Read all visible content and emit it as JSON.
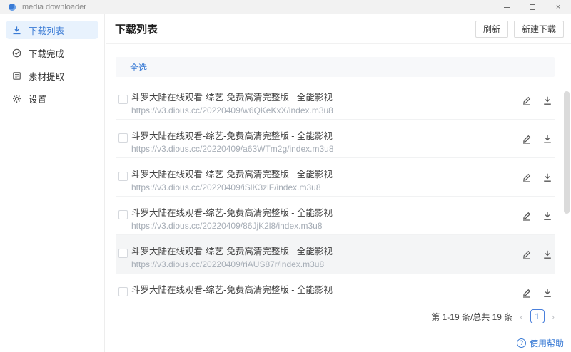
{
  "titlebar": {
    "app_title": "media downloader"
  },
  "icons": {
    "close": "×",
    "help": "?"
  },
  "sidebar": {
    "items": [
      {
        "label": "下载列表",
        "icon": "download-icon",
        "active": true
      },
      {
        "label": "下载完成",
        "icon": "check-circle-icon",
        "active": false
      },
      {
        "label": "素材提取",
        "icon": "extract-icon",
        "active": false
      },
      {
        "label": "设置",
        "icon": "gear-icon",
        "active": false
      }
    ]
  },
  "main": {
    "page_title": "下载列表",
    "refresh_button": "刷新",
    "new_download_button": "新建下载",
    "select_all": "全选"
  },
  "downloads": [
    {
      "title": "斗罗大陆在线观看-综艺-免费高清完整版 - 全能影视",
      "url": "https://v3.dious.cc/20220409/w6QKeKxX/index.m3u8",
      "hovered": false
    },
    {
      "title": "斗罗大陆在线观看-综艺-免费高清完整版 - 全能影视",
      "url": "https://v3.dious.cc/20220409/a63WTm2g/index.m3u8",
      "hovered": false
    },
    {
      "title": "斗罗大陆在线观看-综艺-免费高清完整版 - 全能影视",
      "url": "https://v3.dious.cc/20220409/iSlK3zlF/index.m3u8",
      "hovered": false
    },
    {
      "title": "斗罗大陆在线观看-综艺-免费高清完整版 - 全能影视",
      "url": "https://v3.dious.cc/20220409/86JjK2l8/index.m3u8",
      "hovered": false
    },
    {
      "title": "斗罗大陆在线观看-综艺-免费高清完整版 - 全能影视",
      "url": "https://v3.dious.cc/20220409/riAUS87r/index.m3u8",
      "hovered": true
    },
    {
      "title": "斗罗大陆在线观看-综艺-免费高清完整版 - 全能影视",
      "url": "",
      "hovered": false
    }
  ],
  "pagination": {
    "summary": "第 1-19 条/总共 19 条",
    "prev": "‹",
    "current_page": "1",
    "next": "›"
  },
  "footer": {
    "help": "使用帮助"
  },
  "colors": {
    "accent": "#3a7bd5",
    "active_item_bg": "#e8f2fd",
    "url_gray": "#a6adb6",
    "titlebar_bg": "#f2f2f2"
  }
}
